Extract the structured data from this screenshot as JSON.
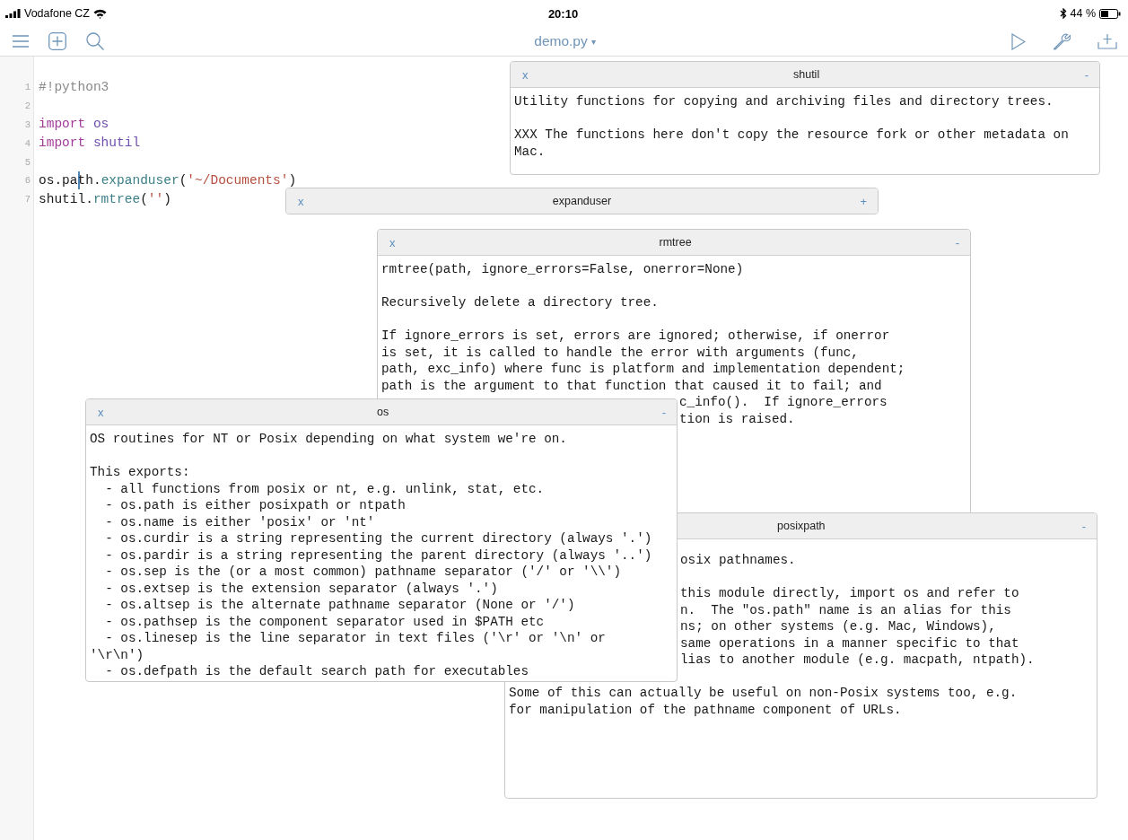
{
  "status_bar": {
    "carrier": "Vodafone CZ",
    "time": "20:10",
    "battery": "44 %"
  },
  "toolbar": {
    "file_name": "demo.py",
    "file_caret": "▾"
  },
  "editor": {
    "lines": [
      {
        "number": "1",
        "tokens": [
          {
            "text": "#!python3",
            "kind": "comment",
            "caret_before": false
          }
        ]
      },
      {
        "number": "2"
      },
      {
        "number": "3",
        "tokens": [
          {
            "text": "import ",
            "kind": "keyword",
            "caret_before": false
          },
          {
            "text": "os",
            "kind": "module",
            "caret_before": false
          }
        ]
      },
      {
        "number": "4",
        "tokens": [
          {
            "text": "import ",
            "kind": "keyword",
            "caret_before": false
          },
          {
            "text": "shutil",
            "kind": "module",
            "caret_before": false
          }
        ]
      },
      {
        "number": "5"
      },
      {
        "number": "6",
        "tokens": [
          {
            "text": "os.pa",
            "kind": "plain",
            "caret_before": false
          },
          {
            "text": "th.",
            "kind": "plain",
            "caret_before": true
          },
          {
            "text": "expanduser",
            "kind": "function",
            "caret_before": false
          },
          {
            "text": "(",
            "kind": "plain",
            "caret_before": false
          },
          {
            "text": "'~/Documents'",
            "kind": "string",
            "caret_before": false
          },
          {
            "text": ")",
            "kind": "plain",
            "caret_before": false
          }
        ]
      },
      {
        "number": "7",
        "tokens": [
          {
            "text": "shutil.",
            "kind": "plain",
            "caret_before": false
          },
          {
            "text": "rmtree",
            "kind": "function",
            "caret_before": false
          },
          {
            "text": "(",
            "kind": "plain",
            "caret_before": false
          },
          {
            "text": "''",
            "kind": "string",
            "caret_before": false
          },
          {
            "text": ")",
            "kind": "plain",
            "caret_before": false
          }
        ]
      }
    ]
  },
  "popups": [
    {
      "title": "shutil",
      "close": "x",
      "toggle": "-",
      "expanded": true,
      "paragraphs": [
        [
          {
            "text": "Utility functions for copying and archiving files and directory trees.",
            "clipped": false
          }
        ],
        [
          {
            "text": "XXX The functions here don't copy the resource fork or other metadata on",
            "clipped": false
          },
          {
            "text": "Mac.",
            "clipped": false
          }
        ]
      ]
    },
    {
      "title": "expanduser",
      "close": "x",
      "toggle": "+",
      "expanded": false
    },
    {
      "title": "rmtree",
      "close": "x",
      "toggle": "-",
      "expanded": true,
      "paragraphs": [
        [
          {
            "text": "rmtree(path, ignore_errors=False, onerror=None)",
            "clipped": false
          }
        ],
        [
          {
            "text": "Recursively delete a directory tree.",
            "clipped": false
          }
        ],
        [
          {
            "text": "If ignore_errors is set, errors are ignored; otherwise, if onerror",
            "clipped": false
          },
          {
            "text": "is set, it is called to handle the error with arguments (func,",
            "clipped": false
          },
          {
            "text": "path, exc_info) where func is platform and implementation dependent;",
            "clipped": false
          },
          {
            "text": "path is the argument to that function that caused it to fail; and",
            "clipped": false
          },
          {
            "text": "c_info().  If ignore_errors",
            "clipped": true
          },
          {
            "text": "tion is raised.",
            "clipped": true
          }
        ]
      ]
    },
    {
      "title": "os",
      "close": "x",
      "toggle": "-",
      "expanded": true,
      "paragraphs": [
        [
          {
            "text": "OS routines for NT or Posix depending on what system we're on.",
            "clipped": false
          }
        ],
        [
          {
            "text": "This exports:",
            "clipped": false
          },
          {
            "text": "  - all functions from posix or nt, e.g. unlink, stat, etc.",
            "clipped": false
          },
          {
            "text": "  - os.path is either posixpath or ntpath",
            "clipped": false
          },
          {
            "text": "  - os.name is either 'posix' or 'nt'",
            "clipped": false
          },
          {
            "text": "  - os.curdir is a string representing the current directory (always '.')",
            "clipped": false
          },
          {
            "text": "  - os.pardir is a string representing the parent directory (always '..')",
            "clipped": false
          },
          {
            "text": "  - os.sep is the (or a most common) pathname separator ('/' or '\\\\')",
            "clipped": false
          },
          {
            "text": "  - os.extsep is the extension separator (always '.')",
            "clipped": false
          },
          {
            "text": "  - os.altsep is the alternate pathname separator (None or '/')",
            "clipped": false
          },
          {
            "text": "  - os.pathsep is the component separator used in $PATH etc",
            "clipped": false
          },
          {
            "text": "  - os.linesep is the line separator in text files ('\\r' or '\\n' or",
            "clipped": false
          },
          {
            "text": "'\\r\\n')",
            "clipped": false
          },
          {
            "text": "  - os.defpath is the default search path for executables",
            "clipped": false
          }
        ]
      ]
    },
    {
      "title": "posixpath",
      "toggle": "-",
      "expanded": true,
      "paragraphs": [
        [
          {
            "text": "osix pathnames.",
            "clipped": true
          }
        ],
        [
          {
            "text": "this module directly, import os and refer to",
            "clipped": true
          },
          {
            "text": "n.  The \"os.path\" name is an alias for this",
            "clipped": true
          },
          {
            "text": "ns; on other systems (e.g. Mac, Windows),",
            "clipped": true
          },
          {
            "text": "same operations in a manner specific to that",
            "clipped": true
          },
          {
            "text": "lias to another module (e.g. macpath, ntpath).",
            "clipped": true
          }
        ],
        [
          {
            "text": "Some of this can actually be useful on non-Posix systems too, e.g.",
            "clipped": false
          },
          {
            "text": "for manipulation of the pathname component of URLs.",
            "clipped": false
          }
        ]
      ]
    }
  ]
}
